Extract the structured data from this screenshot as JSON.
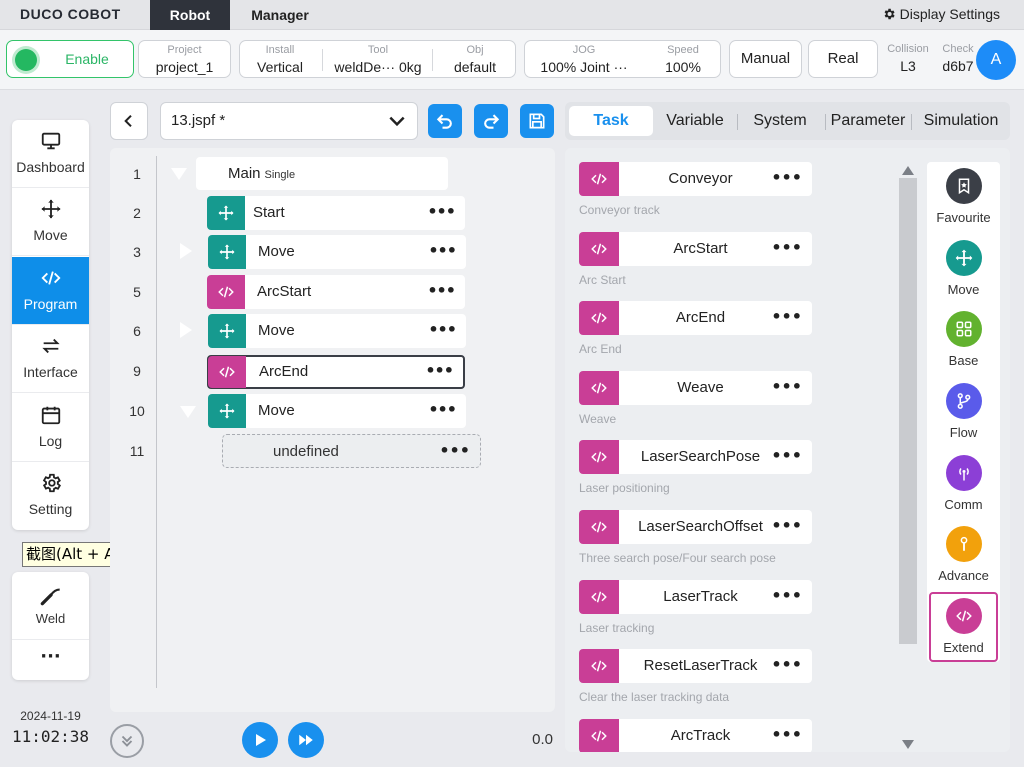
{
  "topbar": {
    "logo": "DUCO COBOT",
    "tabs": [
      {
        "label": "Robot",
        "active": true
      },
      {
        "label": "Manager",
        "active": false
      }
    ],
    "display_settings": "Display Settings"
  },
  "status": {
    "enable": "Enable",
    "project": {
      "label": "Project",
      "value": "project_1"
    },
    "install": {
      "label": "Install",
      "value": "Vertical"
    },
    "tool": {
      "label": "Tool",
      "name": "weldDe···",
      "weight": "0kg"
    },
    "obj": {
      "label": "Obj",
      "value": "default"
    },
    "jog": {
      "label": "JOG",
      "value": "100%  Joint ···"
    },
    "speed": {
      "label": "Speed",
      "value": "100%"
    },
    "mode": "Manual",
    "env": "Real",
    "collision": {
      "label": "Collision",
      "value": "L3"
    },
    "check": {
      "label": "Check",
      "value": "d6b7"
    },
    "avatar": "A"
  },
  "nav": {
    "items": [
      {
        "label": "Dashboard",
        "icon": "monitor-icon",
        "active": false
      },
      {
        "label": "Move",
        "icon": "move-icon",
        "active": false
      },
      {
        "label": "Program",
        "icon": "code-icon",
        "active": true
      },
      {
        "label": "Interface",
        "icon": "swap-icon",
        "active": false
      },
      {
        "label": "Log",
        "icon": "calendar-icon",
        "active": false
      },
      {
        "label": "Setting",
        "icon": "gear-icon",
        "active": false
      }
    ],
    "weld": "Weld",
    "more": "···"
  },
  "tooltip": "截图(Alt + A)",
  "datetime": {
    "date": "2024-11-19",
    "time": "11:02:38"
  },
  "program": {
    "file": "13.jspf *",
    "main": {
      "label": "Main",
      "sub": "Single"
    },
    "rows": [
      {
        "num": "1"
      },
      {
        "num": "2",
        "label": "Start",
        "type": "move"
      },
      {
        "num": "3",
        "label": "Move",
        "type": "move"
      },
      {
        "num": "5",
        "label": "ArcStart",
        "type": "code"
      },
      {
        "num": "6",
        "label": "Move",
        "type": "move"
      },
      {
        "num": "9",
        "label": "ArcEnd",
        "type": "code"
      },
      {
        "num": "10",
        "label": "Move",
        "type": "move"
      },
      {
        "num": "11",
        "label": "undefined"
      }
    ],
    "speed": "0.0"
  },
  "right_tabs": [
    {
      "label": "Task",
      "active": true
    },
    {
      "label": "Variable",
      "active": false
    },
    {
      "label": "System",
      "active": false
    },
    {
      "label": "Parameter",
      "active": false
    },
    {
      "label": "Simulation",
      "active": false
    }
  ],
  "commands": [
    {
      "label": "Conveyor",
      "desc": "Conveyor track"
    },
    {
      "label": "ArcStart",
      "desc": "Arc Start"
    },
    {
      "label": "ArcEnd",
      "desc": "Arc End"
    },
    {
      "label": "Weave",
      "desc": "Weave"
    },
    {
      "label": "LaserSearchPose",
      "desc": "Laser positioning"
    },
    {
      "label": "LaserSearchOffset",
      "desc": "Three search pose/Four search pose"
    },
    {
      "label": "LaserTrack",
      "desc": "Laser tracking"
    },
    {
      "label": "ResetLaserTrack",
      "desc": "Clear the laser tracking data"
    },
    {
      "label": "ArcTrack",
      "desc": ""
    }
  ],
  "categories": [
    {
      "label": "Favourite",
      "color": "#3b3f47"
    },
    {
      "label": "Move",
      "color": "#169a8f"
    },
    {
      "label": "Base",
      "color": "#62b22f"
    },
    {
      "label": "Flow",
      "color": "#5a5bea"
    },
    {
      "label": "Comm",
      "color": "#8c3fd6"
    },
    {
      "label": "Advance",
      "color": "#f2a10c"
    },
    {
      "label": "Extend",
      "color": "#c93e96",
      "active": true
    }
  ],
  "colors": {
    "accent": "#1990ee",
    "move": "#169a8f",
    "code": "#c93e96",
    "enable": "#24b861"
  }
}
